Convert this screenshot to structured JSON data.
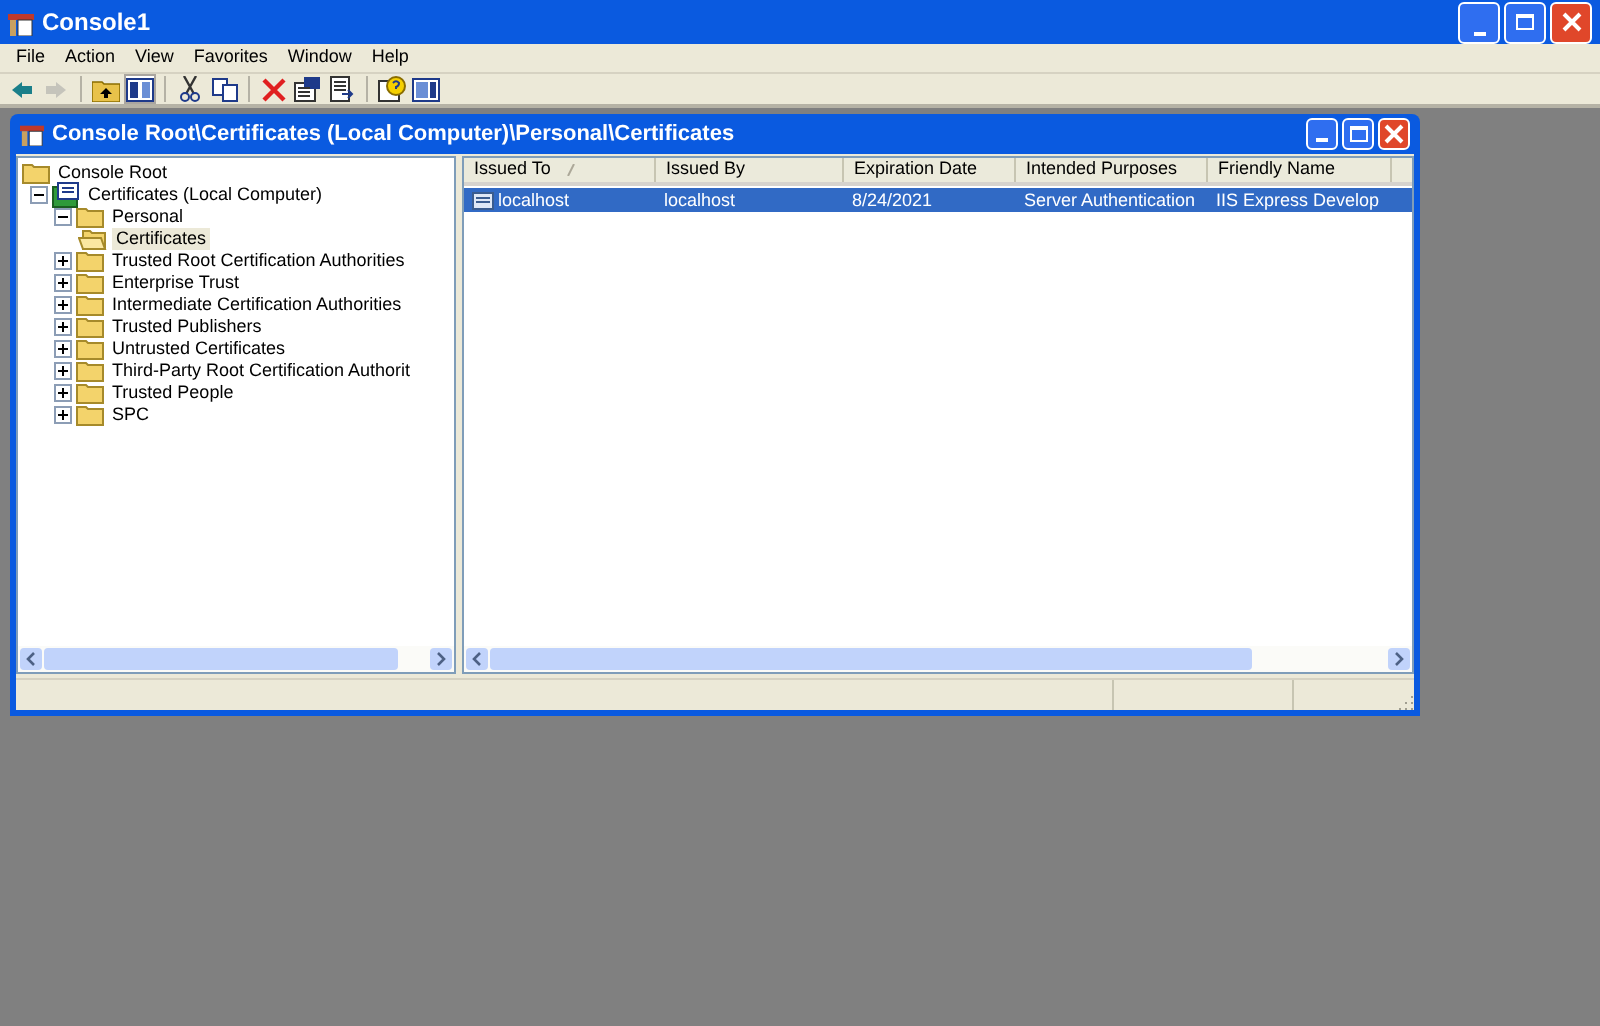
{
  "window": {
    "title": "Console1"
  },
  "menu": [
    "File",
    "Action",
    "View",
    "Favorites",
    "Window",
    "Help"
  ],
  "toolbar": [
    {
      "kind": "back",
      "disabled": false,
      "pressed": false
    },
    {
      "kind": "forward",
      "disabled": true,
      "pressed": false
    },
    {
      "kind": "sep"
    },
    {
      "kind": "up",
      "disabled": false,
      "pressed": false
    },
    {
      "kind": "tree",
      "disabled": false,
      "pressed": true
    },
    {
      "kind": "sep"
    },
    {
      "kind": "cut",
      "disabled": false,
      "pressed": false
    },
    {
      "kind": "copy",
      "disabled": false,
      "pressed": false
    },
    {
      "kind": "sep"
    },
    {
      "kind": "delete",
      "disabled": false,
      "pressed": false
    },
    {
      "kind": "properties",
      "disabled": false,
      "pressed": false
    },
    {
      "kind": "export",
      "disabled": false,
      "pressed": false
    },
    {
      "kind": "sep"
    },
    {
      "kind": "help",
      "disabled": false,
      "pressed": false
    },
    {
      "kind": "pane",
      "disabled": false,
      "pressed": false
    }
  ],
  "child_window": {
    "title": "Console Root\\Certificates (Local Computer)\\Personal\\Certificates",
    "tree": [
      {
        "label": "Console Root",
        "kind": "root",
        "selected": false,
        "children": [
          {
            "label": "Certificates (Local Computer)",
            "kind": "snapin",
            "selected": false,
            "expanded": true,
            "children": [
              {
                "label": "Personal",
                "kind": "folder",
                "selected": false,
                "expanded": true,
                "children": [
                  {
                    "label": "Certificates",
                    "kind": "openfolder",
                    "selected": true
                  }
                ]
              },
              {
                "label": "Trusted Root Certification Authorities",
                "kind": "folder",
                "selected": false,
                "expanded": false
              },
              {
                "label": "Enterprise Trust",
                "kind": "folder",
                "selected": false,
                "expanded": false
              },
              {
                "label": "Intermediate Certification Authorities",
                "kind": "folder",
                "selected": false,
                "expanded": false
              },
              {
                "label": "Trusted Publishers",
                "kind": "folder",
                "selected": false,
                "expanded": false
              },
              {
                "label": "Untrusted Certificates",
                "kind": "folder",
                "selected": false,
                "expanded": false
              },
              {
                "label": "Third-Party Root Certification Authorit",
                "kind": "folder",
                "selected": false,
                "expanded": false
              },
              {
                "label": "Trusted People",
                "kind": "folder",
                "selected": false,
                "expanded": false
              },
              {
                "label": "SPC",
                "kind": "folder",
                "selected": false,
                "expanded": false
              }
            ]
          }
        ]
      }
    ],
    "table": {
      "columns": [
        {
          "label": "Issued To",
          "sorted": true
        },
        {
          "label": "Issued By",
          "sorted": false
        },
        {
          "label": "Expiration Date",
          "sorted": false
        },
        {
          "label": "Intended Purposes",
          "sorted": false
        },
        {
          "label": "Friendly Name",
          "sorted": false
        }
      ],
      "rows": [
        {
          "selected": true,
          "cells": [
            "localhost",
            "localhost",
            "8/24/2021",
            "Server Authentication",
            "IIS Express Develop"
          ]
        }
      ]
    }
  }
}
